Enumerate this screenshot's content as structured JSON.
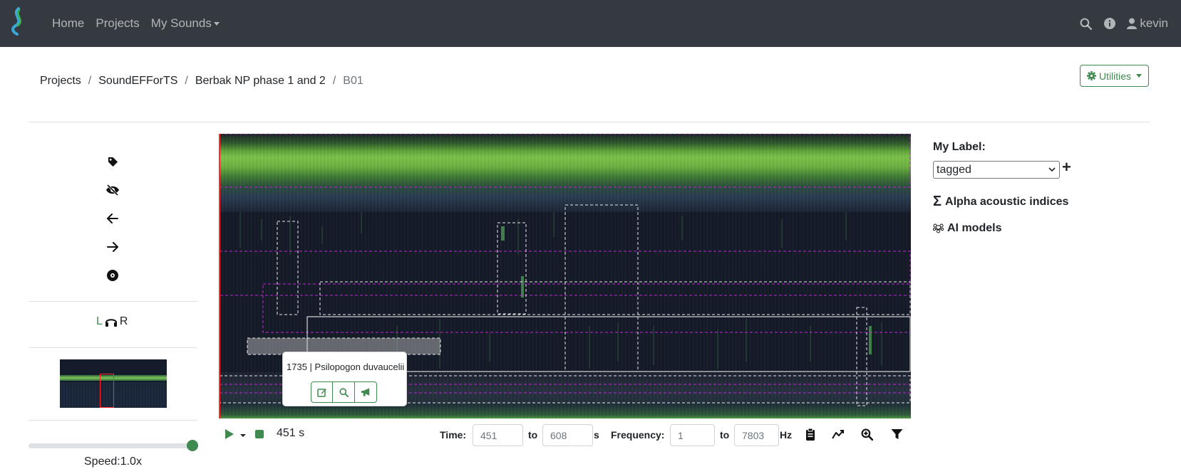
{
  "navbar": {
    "links": [
      {
        "label": "Home"
      },
      {
        "label": "Projects"
      },
      {
        "label": "My Sounds"
      }
    ],
    "user": "kevin"
  },
  "breadcrumb": [
    "Projects",
    "SoundEFForTS",
    "Berbak NP phase 1 and 2",
    "B01"
  ],
  "utilities_label": "Utilities",
  "channels": {
    "left": "L",
    "right": "R"
  },
  "speed_label": "Speed:1.0x",
  "speed_value": 1.0,
  "popup": {
    "title": "1735 | Psilopogon duvaucelii"
  },
  "playback": {
    "current_time": "451 s",
    "time_label": "Time:",
    "time_from": "451",
    "time_to_label": "to",
    "time_to": "608",
    "time_unit": "s",
    "freq_label": "Frequency:",
    "freq_from": "1",
    "freq_to_label": "to",
    "freq_to": "7803",
    "freq_unit": "Hz"
  },
  "right_panel": {
    "my_label": "My Label:",
    "selected_label": "tagged",
    "alpha_indices": "Alpha acoustic indices",
    "ai_models": "AI models"
  },
  "colors": {
    "navbar": "#343a40",
    "accent": "#3f8a4f",
    "spectrogram_bg": "#141a27",
    "playhead": "#ff2a2a",
    "box_magenta": "#c026d3"
  }
}
